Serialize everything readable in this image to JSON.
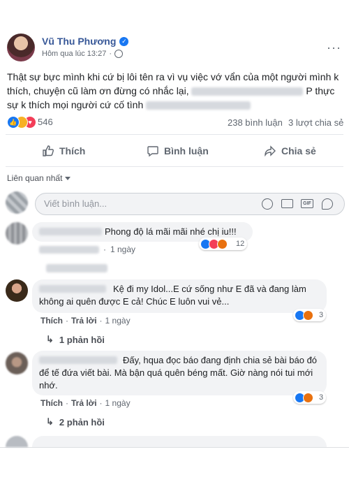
{
  "post": {
    "author": "Vũ Thu Phương",
    "time": "Hôm qua lúc 13:27",
    "text": "Thật sự bực mình khi cứ bị lôi tên ra vì vụ việc vớ vẩn của một người mình k thích, chuyện cũ làm ơn đừng có nhắc lại,",
    "text_middle": "P thực sự k thích mọi người cứ cố tình",
    "reaction_count": "546",
    "comment_count": "238 bình luận",
    "share_count": "3 lượt chia sẻ"
  },
  "actions": {
    "like": "Thích",
    "comment": "Bình luận",
    "share": "Chia sẻ"
  },
  "sort": {
    "label": "Liên quan nhất"
  },
  "composer": {
    "placeholder": "Viết bình luận..."
  },
  "comments": [
    {
      "text": "Phong độ lá mãi mãi nhé chị iu!!!",
      "time": "1 ngày",
      "react_count": "12"
    },
    {
      "text": "Kệ đi my Idol...E cứ sống như E đã và đang làm không ai quên được E cả! Chúc E luôn vui vẻ...",
      "like": "Thích",
      "reply": "Trả lời",
      "time": "1 ngày",
      "react_count": "3",
      "replies": "1 phản hồi"
    },
    {
      "text": "Đấy, hqua đọc báo đang định chia sẻ bài báo đó để tế đứa viết bài. Mà bận quá quên béng mất. Giờ nàng nói tui mới nhớ.",
      "like": "Thích",
      "reply": "Trả lời",
      "time": "1 ngày",
      "react_count": "3",
      "replies": "2 phản hồi"
    }
  ],
  "colors": {
    "link": "#385898",
    "like_blue": "#1877f2",
    "love_red": "#f33e58",
    "haha_yellow": "#f7b125",
    "angry_orange": "#e9710f"
  },
  "icons": [
    "verified-icon",
    "globe-icon",
    "more-icon",
    "like-icon",
    "comment-icon",
    "share-icon",
    "emoji-icon",
    "camera-icon",
    "gif-icon",
    "sticker-icon",
    "reply-arrow-icon"
  ]
}
